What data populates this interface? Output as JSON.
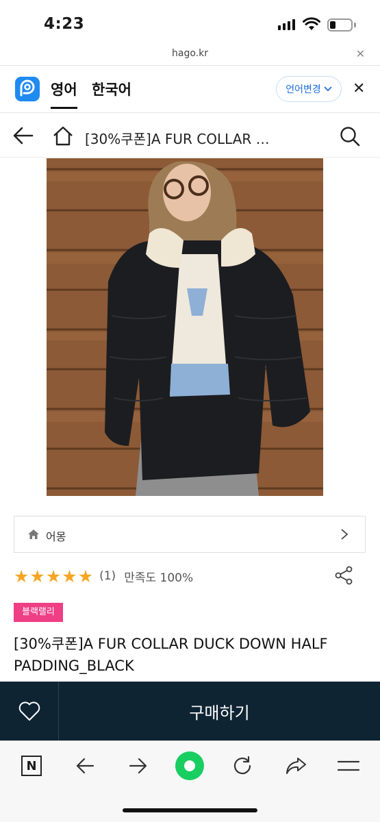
{
  "status_bar": {
    "time": "4:23"
  },
  "url_bar": {
    "domain": "hago.kr"
  },
  "translate_bar": {
    "source_lang": "영어",
    "target_lang": "한국어",
    "change_label": "언어변경",
    "accent_color": "#1f8bf0"
  },
  "header": {
    "title": "[30%쿠폰]A FUR COLLAR …"
  },
  "brand": {
    "name": "어몽"
  },
  "rating": {
    "stars": 5,
    "count": "(1)",
    "satisfaction": "만족도 100%"
  },
  "badge": {
    "label": "블랙랠리",
    "color": "#ef3f85"
  },
  "product": {
    "name": "[30%쿠폰]A FUR COLLAR DUCK DOWN HALF PADDING_BLACK"
  },
  "buy_bar": {
    "buy_label": "구매하기",
    "background": "#0f2433"
  },
  "browser_toolbar": {
    "icons": [
      "naver-n-icon",
      "back-arrow-icon",
      "forward-arrow-icon",
      "green-home-icon",
      "refresh-icon",
      "share-icon",
      "menu-icon"
    ]
  }
}
